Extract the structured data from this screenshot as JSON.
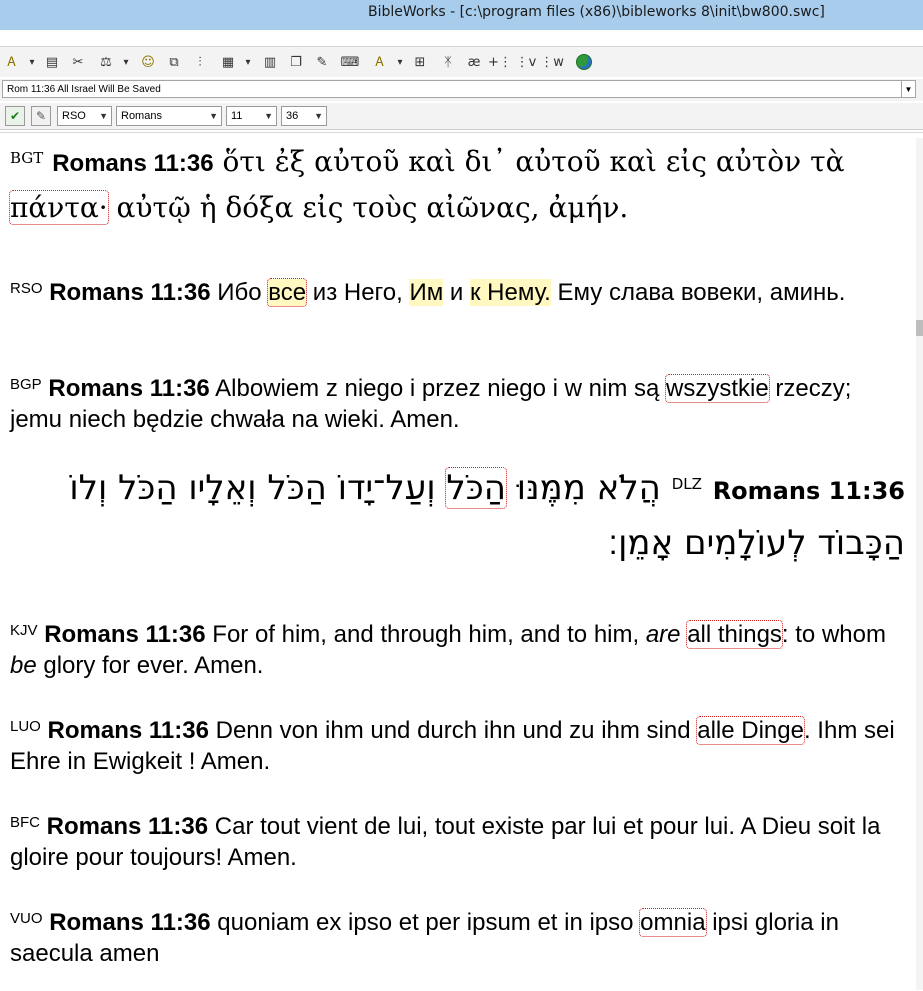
{
  "window": {
    "title": "BibleWorks - [c:\\program files (x86)\\bibleworks 8\\init\\bw800.swc]"
  },
  "toolbar": {
    "icons": [
      "search-options-icon",
      "dropdown-icon",
      "toolbox-icon",
      "tools-icon",
      "version-icon",
      "dropdown-icon",
      "users-icon",
      "windows-icon",
      "parallel-icon",
      "grid-icon",
      "dropdown-icon",
      "list-icon",
      "copy-icon",
      "export-icon",
      "keyboard-icon",
      "options-icon",
      "dropdown-icon",
      "arrange-icon",
      "note-icon",
      "lexicon-icon",
      "plus-icon",
      "text-v-icon",
      "text-w-icon",
      "globe-icon"
    ],
    "labels": [
      "Ꭺ",
      "▾",
      "▤",
      "✂",
      "⚖",
      "▾",
      "☺",
      "⧉",
      "⫶",
      "▦",
      "▾",
      "▥",
      "❐",
      "✎",
      "⌨",
      "Ꭺ",
      "▾",
      "⊞",
      "ᛡ",
      "ӕ",
      "+⋮",
      "⋮v",
      "⋮w",
      ""
    ]
  },
  "reference_bar": {
    "value": "Rom 11:36 All Israel Will Be Saved"
  },
  "nav": {
    "version": "RSO",
    "book": "Romans",
    "chapter": "11",
    "verse": "36"
  },
  "verses": [
    {
      "version": "BGT",
      "reference": "Romans 11:36",
      "before": "ὅτι ἐξ αὐτοῦ καὶ δι᾽ αὐτοῦ καὶ εἰς αὐτὸν τὰ ",
      "boxed": "πάντα·",
      "after": " αὐτῷ ἡ δόξα εἰς τοὺς αἰῶνας, ἀμήν."
    },
    {
      "version": "RSO",
      "reference": "Romans 11:36",
      "t1": " Ибо ",
      "boxed": "все",
      "t2": " из Него, ",
      "hl1": "Им",
      "t3": " и ",
      "hl2": "к Нему.",
      "t4": " Ему слава вовеки, аминь."
    },
    {
      "version": "BGP",
      "reference": "Romans 11:36",
      "before": " Albowiem z niego i przez niego i w nim są ",
      "boxed": "wszystkie",
      "after": " rzeczy; jemu niech będzie chwała na wieki. Amen."
    },
    {
      "version": "DLZ",
      "reference": "Romans 11:36",
      "before": "הֲלֹא מִמֶּנּוּ ",
      "boxed": "הַכֹּל",
      "after": " וְעַל־יָדוֹ הַכֹּל וְאֵלָיו הַכֹּל וְלוֹ הַכָּבוֹד לְעוֹלָמִים אָמֵן׃"
    },
    {
      "version": "KJV",
      "reference": "Romans 11:36",
      "t1": " For of him, and through him, and to him, ",
      "it1": "are",
      "t2": " ",
      "boxed": "all things",
      "t3": ": to whom ",
      "it2": "be",
      "t4": " glory for ever. Amen."
    },
    {
      "version": "LUO",
      "reference": "Romans 11:36",
      "before": " Denn von ihm und durch ihn und zu ihm sind ",
      "boxed": "alle Dinge",
      "after": ". Ihm sei Ehre in Ewigkeit ! Amen."
    },
    {
      "version": "BFC",
      "reference": "Romans 11:36",
      "text": " Car tout vient de lui, tout existe par lui et pour lui. A Dieu soit la gloire pour toujours! Amen."
    },
    {
      "version": "VUO",
      "reference": "Romans 11:36",
      "before": " quoniam ex ipso et per ipsum et in ipso ",
      "boxed": "omnia",
      "after": " ipsi gloria in saecula amen"
    }
  ]
}
